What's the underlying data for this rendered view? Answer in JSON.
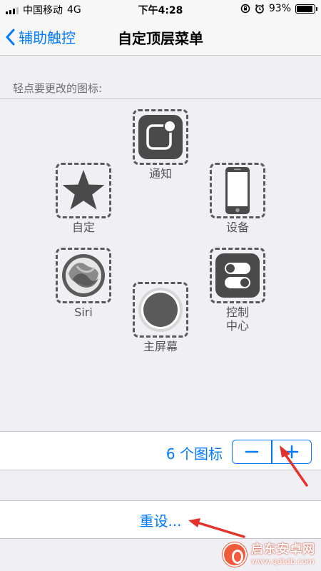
{
  "status_bar": {
    "carrier": "中国移动",
    "network": "4G",
    "time": "下午4:28",
    "battery": "93%",
    "battery_level": 0.93
  },
  "nav": {
    "back_label": "辅助触控",
    "title": "自定顶层菜单"
  },
  "section_header": "轻点要更改的图标:",
  "icons": {
    "notifications": "通知",
    "custom": "自定",
    "device": "设备",
    "siri": "Siri",
    "control_center": "控制\n中心",
    "home": "主屏幕"
  },
  "count_row": {
    "count_text": "6 个图标",
    "minus": "−",
    "plus": "+"
  },
  "reset": {
    "label": "重设..."
  },
  "watermark": {
    "name": "启东安卓网",
    "url": "www.qdtdb.com"
  },
  "colors": {
    "accent": "#007aff",
    "icon_tile": "#4a4a4a",
    "annotation_arrow": "#e5302b"
  }
}
